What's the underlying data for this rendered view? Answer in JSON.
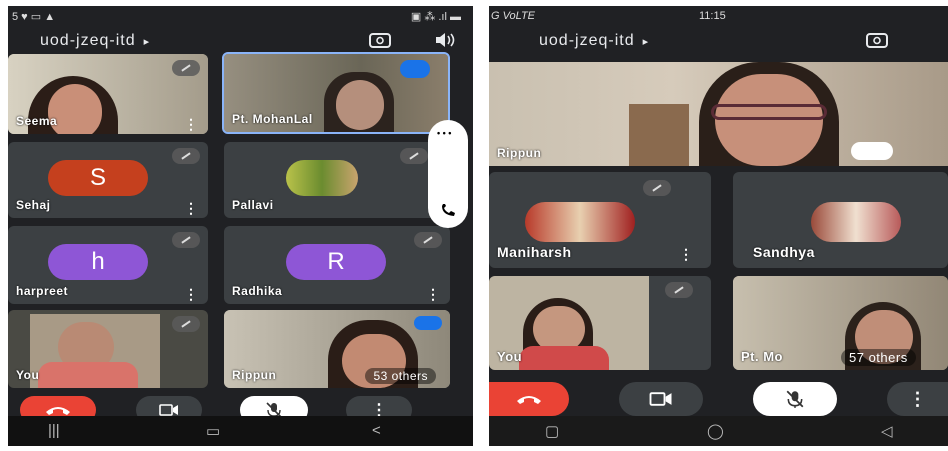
{
  "left_phone": {
    "status_left": "5 ♥ ▭ ▲",
    "status_right": "▣ ⁂ .ıl ▬",
    "meeting_code": "uod-jzeq-itd",
    "arrow": "▸",
    "tiles": [
      {
        "name": "Seema"
      },
      {
        "name": "Pt. MohanLal"
      },
      {
        "name": "Sehaj",
        "initial": "S",
        "color": "#c5401e"
      },
      {
        "name": "Pallavi"
      },
      {
        "name": "harpreet",
        "initial": "h",
        "color": "#8e56d6"
      },
      {
        "name": "Radhika",
        "initial": "R",
        "color": "#8e56d6"
      },
      {
        "name": "You"
      },
      {
        "name": "Rippun"
      }
    ],
    "others": "53 others",
    "menu_dots": "• • •"
  },
  "right_phone": {
    "status_left": "G VoLTE",
    "status_time": "11:15",
    "meeting_code": "uod-jzeq-itd",
    "arrow": "▸",
    "tiles": [
      {
        "name": "Rippun"
      },
      {
        "name": "Maniharsh"
      },
      {
        "name": "Sandhya"
      },
      {
        "name": "You"
      },
      {
        "name": "Pt. Mo"
      }
    ],
    "others": "57 others"
  },
  "colors": {
    "end_call": "#ea4335",
    "bg": "#202124",
    "tile": "#3c4043",
    "pin_badge": "#1a73e8"
  }
}
